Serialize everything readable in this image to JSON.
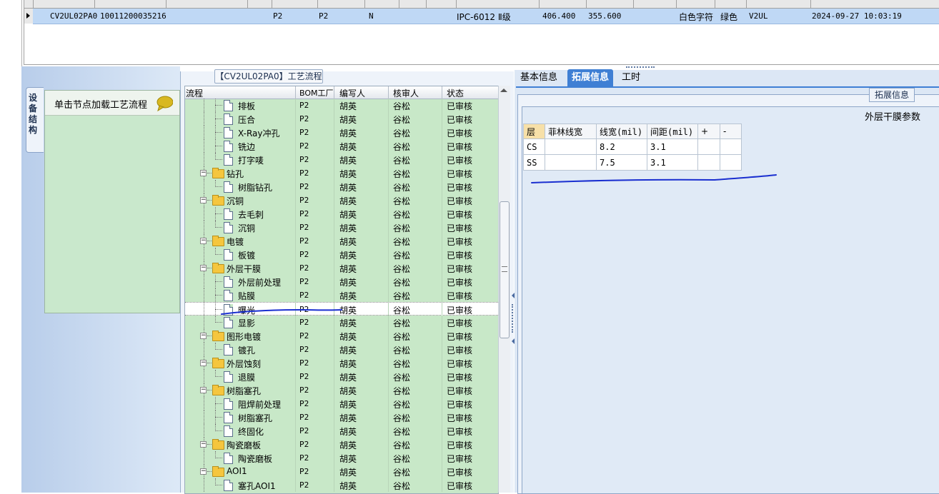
{
  "top_grid": {
    "row": {
      "code": "CV2UL02PA0",
      "number": "10011200035216",
      "c1": "P2",
      "c2": "P2",
      "c3": "N",
      "material": "IPC-6012 Ⅱ级",
      "v1": "406.400",
      "v2": "355.600",
      "text_char": "白色字符",
      "color": "绿色",
      "series": "V2UL",
      "datetime": "2024-09-27 10:03:19"
    }
  },
  "left_panel": {
    "tab_label": "设备结构",
    "hint": "单击节点加载工艺流程"
  },
  "tree": {
    "title": "【CV2UL02PA0】工艺流程",
    "columns": [
      "流程",
      "BOM工厂",
      "编写人",
      "核审人",
      "状态"
    ],
    "rows": [
      {
        "name": "排板",
        "level": 2,
        "bom": "P2",
        "author": "胡英",
        "reviewer": "谷松",
        "status": "已审核"
      },
      {
        "name": "压合",
        "level": 2,
        "bom": "P2",
        "author": "胡英",
        "reviewer": "谷松",
        "status": "已审核"
      },
      {
        "name": "X-Ray冲孔",
        "level": 2,
        "bom": "P2",
        "author": "胡英",
        "reviewer": "谷松",
        "status": "已审核"
      },
      {
        "name": "铣边",
        "level": 2,
        "bom": "P2",
        "author": "胡英",
        "reviewer": "谷松",
        "status": "已审核"
      },
      {
        "name": "打字唛",
        "level": 2,
        "bom": "P2",
        "author": "胡英",
        "reviewer": "谷松",
        "status": "已审核"
      },
      {
        "name": "钻孔",
        "level": 1,
        "bom": "P2",
        "author": "胡英",
        "reviewer": "谷松",
        "status": "已审核"
      },
      {
        "name": "树脂钻孔",
        "level": 2,
        "bom": "P2",
        "author": "胡英",
        "reviewer": "谷松",
        "status": "已审核"
      },
      {
        "name": "沉铜",
        "level": 1,
        "bom": "P2",
        "author": "胡英",
        "reviewer": "谷松",
        "status": "已审核"
      },
      {
        "name": "去毛刺",
        "level": 2,
        "bom": "P2",
        "author": "胡英",
        "reviewer": "谷松",
        "status": "已审核"
      },
      {
        "name": "沉铜",
        "level": 2,
        "bom": "P2",
        "author": "胡英",
        "reviewer": "谷松",
        "status": "已审核"
      },
      {
        "name": "电镀",
        "level": 1,
        "bom": "P2",
        "author": "胡英",
        "reviewer": "谷松",
        "status": "已审核"
      },
      {
        "name": "板镀",
        "level": 2,
        "bom": "P2",
        "author": "胡英",
        "reviewer": "谷松",
        "status": "已审核"
      },
      {
        "name": "外层干膜",
        "level": 1,
        "bom": "P2",
        "author": "胡英",
        "reviewer": "谷松",
        "status": "已审核"
      },
      {
        "name": "外层前处理",
        "level": 2,
        "bom": "P2",
        "author": "胡英",
        "reviewer": "谷松",
        "status": "已审核"
      },
      {
        "name": "贴膜",
        "level": 2,
        "bom": "P2",
        "author": "胡英",
        "reviewer": "谷松",
        "status": "已审核"
      },
      {
        "name": "曝光",
        "level": 2,
        "bom": "P2",
        "author": "胡英",
        "reviewer": "谷松",
        "status": "已审核",
        "selected": true
      },
      {
        "name": "显影",
        "level": 2,
        "bom": "P2",
        "author": "胡英",
        "reviewer": "谷松",
        "status": "已审核"
      },
      {
        "name": "图形电镀",
        "level": 1,
        "bom": "P2",
        "author": "胡英",
        "reviewer": "谷松",
        "status": "已审核"
      },
      {
        "name": "镀孔",
        "level": 2,
        "bom": "P2",
        "author": "胡英",
        "reviewer": "谷松",
        "status": "已审核"
      },
      {
        "name": "外层蚀刻",
        "level": 1,
        "bom": "P2",
        "author": "胡英",
        "reviewer": "谷松",
        "status": "已审核"
      },
      {
        "name": "退膜",
        "level": 2,
        "bom": "P2",
        "author": "胡英",
        "reviewer": "谷松",
        "status": "已审核"
      },
      {
        "name": "树脂塞孔",
        "level": 1,
        "bom": "P2",
        "author": "胡英",
        "reviewer": "谷松",
        "status": "已审核"
      },
      {
        "name": "阻焊前处理",
        "level": 2,
        "bom": "P2",
        "author": "胡英",
        "reviewer": "谷松",
        "status": "已审核"
      },
      {
        "name": "树脂塞孔",
        "level": 2,
        "bom": "P2",
        "author": "胡英",
        "reviewer": "谷松",
        "status": "已审核"
      },
      {
        "name": "终固化",
        "level": 2,
        "bom": "P2",
        "author": "胡英",
        "reviewer": "谷松",
        "status": "已审核"
      },
      {
        "name": "陶瓷磨板",
        "level": 1,
        "bom": "P2",
        "author": "胡英",
        "reviewer": "谷松",
        "status": "已审核"
      },
      {
        "name": "陶瓷磨板",
        "level": 2,
        "bom": "P2",
        "author": "胡英",
        "reviewer": "谷松",
        "status": "已审核"
      },
      {
        "name": "AOI1",
        "level": 1,
        "bom": "P2",
        "author": "胡英",
        "reviewer": "谷松",
        "status": "已审核"
      },
      {
        "name": "塞孔AOI1",
        "level": 2,
        "bom": "P2",
        "author": "胡英",
        "reviewer": "谷松",
        "status": "已审核"
      }
    ]
  },
  "right_panel": {
    "tabs": [
      "基本信息",
      "拓展信息",
      "工时"
    ],
    "active_tab": "拓展信息",
    "group_title": "拓展信息",
    "params_title": "外层干膜参数",
    "table": {
      "headers": [
        "层",
        "菲林线宽",
        "线宽(mil)",
        "间距(mil)",
        "+",
        "-"
      ],
      "rows": [
        [
          "CS",
          "",
          "8.2",
          "3.1",
          "",
          ""
        ],
        [
          "SS",
          "",
          "7.5",
          "3.1",
          "",
          ""
        ]
      ]
    }
  },
  "colors": {
    "tree_bg": "#c8e8c8",
    "selected_row": "#bfd8f5",
    "active_tab": "#3f7fd4",
    "pen": "#1a2fd0"
  }
}
